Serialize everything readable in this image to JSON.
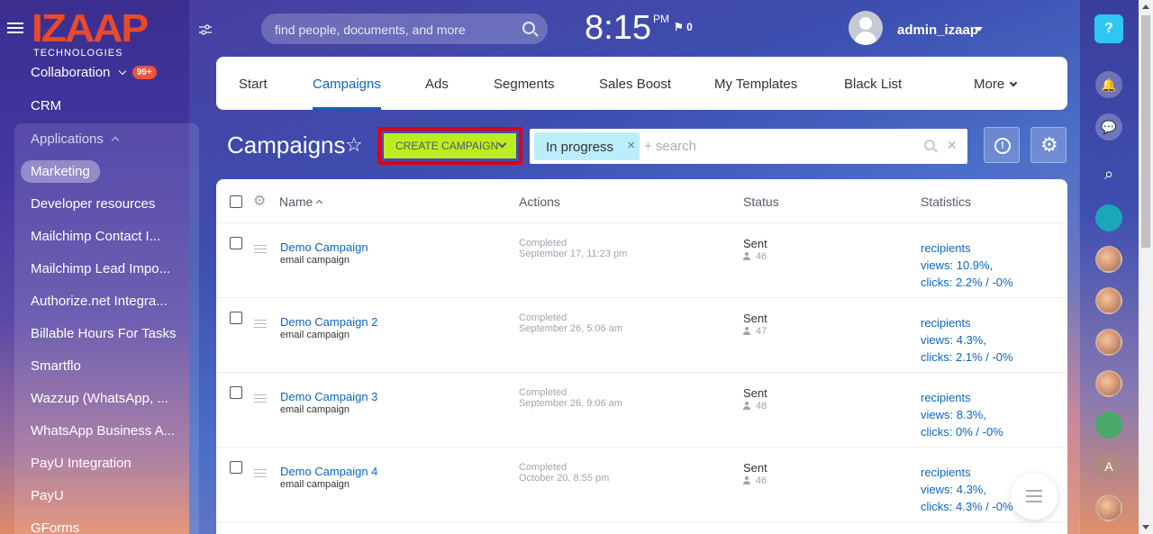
{
  "brand": {
    "logo_main": "IZAAP",
    "logo_sub": "TECHNOLOGIES"
  },
  "sidebar": {
    "collaboration": "Collaboration",
    "collaboration_badge": "99+",
    "crm": "CRM",
    "applications": "Applications",
    "items": [
      "Marketing",
      "Developer resources",
      "Mailchimp Contact I...",
      "Mailchimp Lead Impo...",
      "Authorize.net Integra...",
      "Billable Hours For Tasks",
      "Smartflo",
      "Wazzup (WhatsApp, ...",
      "WhatsApp Business A...",
      "PayU Integration",
      "PayU",
      "GForms"
    ]
  },
  "header": {
    "search_placeholder": "find people, documents, and more",
    "time": "8:15",
    "ampm": "PM",
    "flag_count": "0",
    "user": "admin_izaap"
  },
  "tabs": [
    "Start",
    "Campaigns",
    "Ads",
    "Segments",
    "Sales Boost",
    "My Templates",
    "Black List",
    "More"
  ],
  "title": "Campaigns",
  "create_button": "CREATE CAMPAIGN",
  "filter": {
    "chip": "In progress",
    "chip_remove": "×",
    "search": "+ search",
    "clear": "×"
  },
  "info_glyph": "!",
  "settings_glyph": "⚙",
  "grid": {
    "settings_glyph": "⚙",
    "columns": [
      "Name",
      "Actions",
      "Status",
      "Statistics"
    ],
    "rows": [
      {
        "name": "Demo Campaign",
        "type": "email campaign",
        "action": "Completed",
        "date": "September 17, 11:23 pm",
        "status": "Sent",
        "count": "46",
        "recipients": "recipients",
        "views": "views: 10.9%,",
        "clicks": "clicks: 2.2% / -0%"
      },
      {
        "name": "Demo Campaign 2",
        "type": "email campaign",
        "action": "Completed",
        "date": "September 26, 5:06 am",
        "status": "Sent",
        "count": "47",
        "recipients": "recipients",
        "views": "views: 4.3%,",
        "clicks": "clicks: 2.1% / -0%"
      },
      {
        "name": "Demo Campaign 3",
        "type": "email campaign",
        "action": "Completed",
        "date": "September 26, 9:06 am",
        "status": "Sent",
        "count": "48",
        "recipients": "recipients",
        "views": "views: 8.3%,",
        "clicks": "clicks: 0% / -0%"
      },
      {
        "name": "Demo Campaign 4",
        "type": "email campaign",
        "action": "Completed",
        "date": "October 20, 8:55 pm",
        "status": "Sent",
        "count": "46",
        "recipients": "recipients",
        "views": "views: 4.3%,",
        "clicks": "clicks: 4.3% / -0%"
      }
    ]
  },
  "right_bar": {
    "help": "?",
    "letter_avatar": "A"
  },
  "colors": {
    "accent": "#0b66c3",
    "create": "#bbed21",
    "highlight": "#e0000e",
    "chip": "#bcedfc",
    "badge": "#f0533a"
  }
}
